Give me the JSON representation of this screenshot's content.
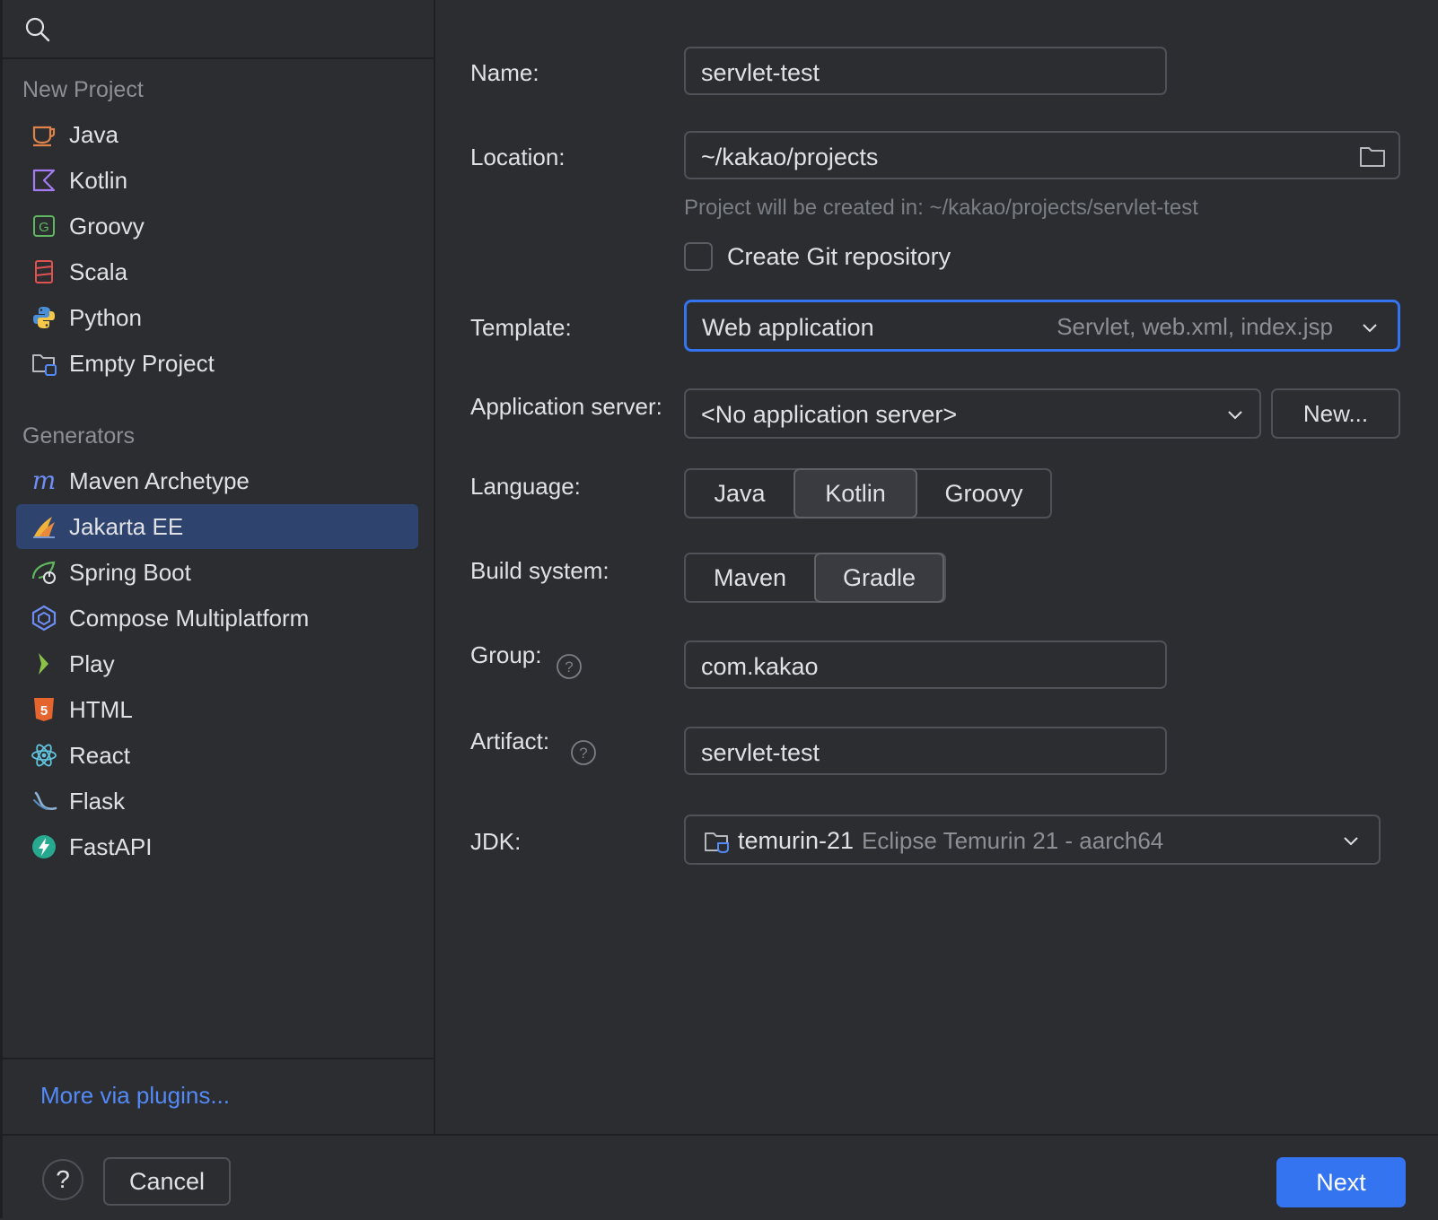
{
  "sidebar": {
    "new_project_label": "New Project",
    "new_project_items": [
      {
        "label": "Java",
        "icon": "java-cup-icon"
      },
      {
        "label": "Kotlin",
        "icon": "kotlin-icon"
      },
      {
        "label": "Groovy",
        "icon": "groovy-icon"
      },
      {
        "label": "Scala",
        "icon": "scala-icon"
      },
      {
        "label": "Python",
        "icon": "python-icon"
      },
      {
        "label": "Empty Project",
        "icon": "empty-project-icon"
      }
    ],
    "generators_label": "Generators",
    "generator_items": [
      {
        "label": "Maven Archetype",
        "icon": "maven-icon"
      },
      {
        "label": "Jakarta EE",
        "icon": "jakarta-icon",
        "selected": true
      },
      {
        "label": "Spring Boot",
        "icon": "spring-boot-icon"
      },
      {
        "label": "Compose Multiplatform",
        "icon": "compose-icon"
      },
      {
        "label": "Play",
        "icon": "play-icon"
      },
      {
        "label": "HTML",
        "icon": "html5-icon"
      },
      {
        "label": "React",
        "icon": "react-icon"
      },
      {
        "label": "Flask",
        "icon": "flask-icon"
      },
      {
        "label": "FastAPI",
        "icon": "fastapi-icon"
      }
    ],
    "plugins_link": "More via plugins..."
  },
  "form": {
    "name_label": "Name:",
    "name_value": "servlet-test",
    "location_label": "Location:",
    "location_value": "~/kakao/projects",
    "location_hint": "Project will be created in: ~/kakao/projects/servlet-test",
    "git_checkbox_label": "Create Git repository",
    "git_checked": false,
    "template_label": "Template:",
    "template_value": "Web application",
    "template_detail": "Servlet, web.xml, index.jsp",
    "app_server_label": "Application server:",
    "app_server_value": "<No application server>",
    "app_server_new": "New...",
    "language_label": "Language:",
    "language_options": [
      "Java",
      "Kotlin",
      "Groovy"
    ],
    "language_selected": "Kotlin",
    "build_label": "Build system:",
    "build_options": [
      "Maven",
      "Gradle"
    ],
    "build_selected": "Gradle",
    "group_label": "Group:",
    "group_value": "com.kakao",
    "artifact_label": "Artifact:",
    "artifact_value": "servlet-test",
    "jdk_label": "JDK:",
    "jdk_value": "temurin-21",
    "jdk_detail": "Eclipse Temurin 21 - aarch64"
  },
  "footer": {
    "help": "?",
    "cancel": "Cancel",
    "next": "Next"
  },
  "colors": {
    "accent": "#3574f0",
    "selected_row": "#2e436e",
    "link": "#548af7",
    "background": "#2b2d30"
  }
}
